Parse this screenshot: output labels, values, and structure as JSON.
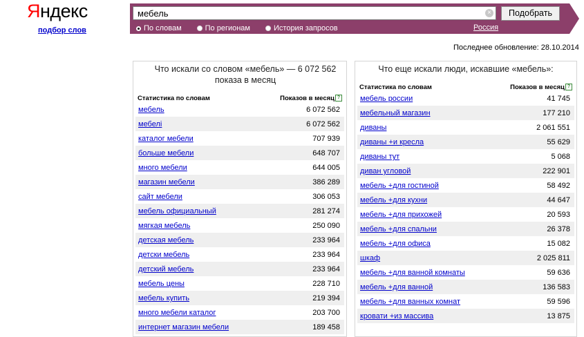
{
  "logo": {
    "first": "Я",
    "rest": "ндекс"
  },
  "sublink": "подбор слов",
  "search": {
    "value": "мебель",
    "clear_glyph": "×",
    "button": "Подобрать",
    "modes": [
      {
        "label": "По словам",
        "selected": true
      },
      {
        "label": "По регионам",
        "selected": false
      },
      {
        "label": "История запросов",
        "selected": false
      }
    ],
    "region": "Россия"
  },
  "updated": "Последнее обновление: 28.10.2014",
  "left": {
    "title": "Что искали со словом «мебель» — 6 072 562 показа в месяц",
    "col1": "Статистика по словам",
    "col2": "Показов в месяц",
    "help": "?",
    "rows": [
      [
        "мебель",
        "6 072 562"
      ],
      [
        "мебелі",
        "6 072 562"
      ],
      [
        "каталог мебели",
        "707 939"
      ],
      [
        "больше мебели",
        "648 707"
      ],
      [
        "много мебели",
        "644 005"
      ],
      [
        "магазин мебели",
        "386 289"
      ],
      [
        "сайт мебели",
        "306 053"
      ],
      [
        "мебель официальный",
        "281 274"
      ],
      [
        "мягкая мебель",
        "250 090"
      ],
      [
        "детская мебель",
        "233 964"
      ],
      [
        "детски мебель",
        "233 964"
      ],
      [
        "детский мебель",
        "233 964"
      ],
      [
        "мебель цены",
        "228 710"
      ],
      [
        "мебель купить",
        "219 394"
      ],
      [
        "много мебели каталог",
        "203 700"
      ],
      [
        "интернет магазин мебели",
        "189 458"
      ]
    ]
  },
  "right": {
    "title": "Что еще искали люди, искавшие «мебель»:",
    "col1": "Статистика по словам",
    "col2": "Показов в месяц",
    "help": "?",
    "rows": [
      [
        "мебель россии",
        "41 745"
      ],
      [
        "мебельный магазин",
        "177 210"
      ],
      [
        "диваны",
        "2 061 551"
      ],
      [
        "диваны +и кресла",
        "55 629"
      ],
      [
        "диваны тут",
        "5 068"
      ],
      [
        "диван угловой",
        "222 901"
      ],
      [
        "мебель +для гостиной",
        "58 492"
      ],
      [
        "мебель +для кухни",
        "44 647"
      ],
      [
        "мебель +для прихожей",
        "20 593"
      ],
      [
        "мебель +для спальни",
        "26 378"
      ],
      [
        "мебель +для офиса",
        "15 082"
      ],
      [
        "шкаф",
        "2 025 811"
      ],
      [
        "мебель +для ванной комнаты",
        "59 636"
      ],
      [
        "мебель +для ванной",
        "136 583"
      ],
      [
        "мебель +для ванных комнат",
        "59 596"
      ],
      [
        "кровати +из массива",
        "13 875"
      ]
    ]
  }
}
